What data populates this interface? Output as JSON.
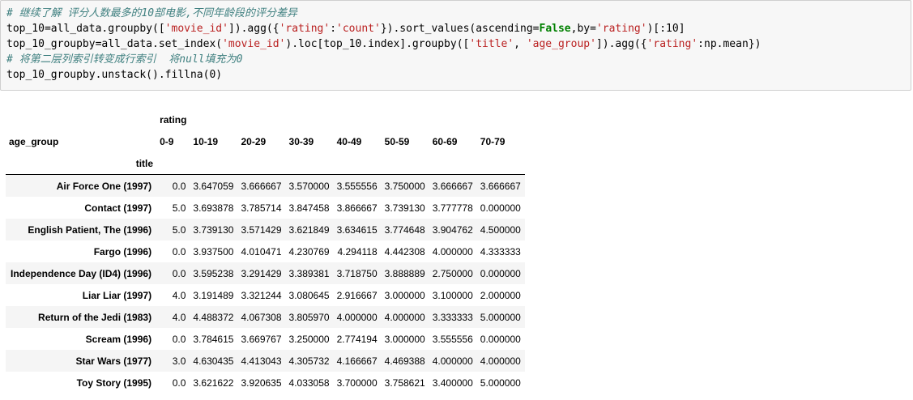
{
  "code_cell": {
    "lines": [
      {
        "text": "# 继续了解 评分人数最多的10部电影,不同年龄段的评分差异",
        "kind": "comment"
      },
      {
        "text": "top_10=all_data.groupby(['movie_id']).agg({'rating':'count'}).sort_values(ascending=False,by='rating')[:10]",
        "kind": "code"
      },
      {
        "text": "top_10_groupby=all_data.set_index('movie_id').loc[top_10.index].groupby(['title', 'age_group']).agg({'rating':np.mean})",
        "kind": "code"
      },
      {
        "text": "# 将第二层列索引转变成行索引  将null填充为0",
        "kind": "comment"
      },
      {
        "text": "top_10_groupby.unstack().fillna(0)",
        "kind": "code"
      }
    ]
  },
  "dataframe": {
    "column_level_0": "rating",
    "column_index_name": "age_group",
    "row_index_name": "title",
    "columns": [
      "0-9",
      "10-19",
      "20-29",
      "30-39",
      "40-49",
      "50-59",
      "60-69",
      "70-79"
    ],
    "rows": [
      {
        "title": "Air Force One (1997)",
        "values": [
          "0.0",
          "3.647059",
          "3.666667",
          "3.570000",
          "3.555556",
          "3.750000",
          "3.666667",
          "3.666667"
        ]
      },
      {
        "title": "Contact (1997)",
        "values": [
          "5.0",
          "3.693878",
          "3.785714",
          "3.847458",
          "3.866667",
          "3.739130",
          "3.777778",
          "0.000000"
        ]
      },
      {
        "title": "English Patient, The (1996)",
        "values": [
          "5.0",
          "3.739130",
          "3.571429",
          "3.621849",
          "3.634615",
          "3.774648",
          "3.904762",
          "4.500000"
        ]
      },
      {
        "title": "Fargo (1996)",
        "values": [
          "0.0",
          "3.937500",
          "4.010471",
          "4.230769",
          "4.294118",
          "4.442308",
          "4.000000",
          "4.333333"
        ]
      },
      {
        "title": "Independence Day (ID4) (1996)",
        "values": [
          "0.0",
          "3.595238",
          "3.291429",
          "3.389381",
          "3.718750",
          "3.888889",
          "2.750000",
          "0.000000"
        ]
      },
      {
        "title": "Liar Liar (1997)",
        "values": [
          "4.0",
          "3.191489",
          "3.321244",
          "3.080645",
          "2.916667",
          "3.000000",
          "3.100000",
          "2.000000"
        ]
      },
      {
        "title": "Return of the Jedi (1983)",
        "values": [
          "4.0",
          "4.488372",
          "4.067308",
          "3.805970",
          "4.000000",
          "4.000000",
          "3.333333",
          "5.000000"
        ]
      },
      {
        "title": "Scream (1996)",
        "values": [
          "0.0",
          "3.784615",
          "3.669767",
          "3.250000",
          "2.774194",
          "3.000000",
          "3.555556",
          "0.000000"
        ]
      },
      {
        "title": "Star Wars (1977)",
        "values": [
          "3.0",
          "4.630435",
          "4.413043",
          "4.305732",
          "4.166667",
          "4.469388",
          "4.000000",
          "4.000000"
        ]
      },
      {
        "title": "Toy Story (1995)",
        "values": [
          "0.0",
          "3.621622",
          "3.920635",
          "4.033058",
          "3.700000",
          "3.758621",
          "3.400000",
          "5.000000"
        ]
      }
    ]
  },
  "colors": {
    "code_background": "#f7f7f7",
    "code_border": "#cfcfcf",
    "comment": "#408080",
    "keyword": "#008000",
    "string": "#ba2121",
    "row_stripe": "#f5f5f5"
  }
}
